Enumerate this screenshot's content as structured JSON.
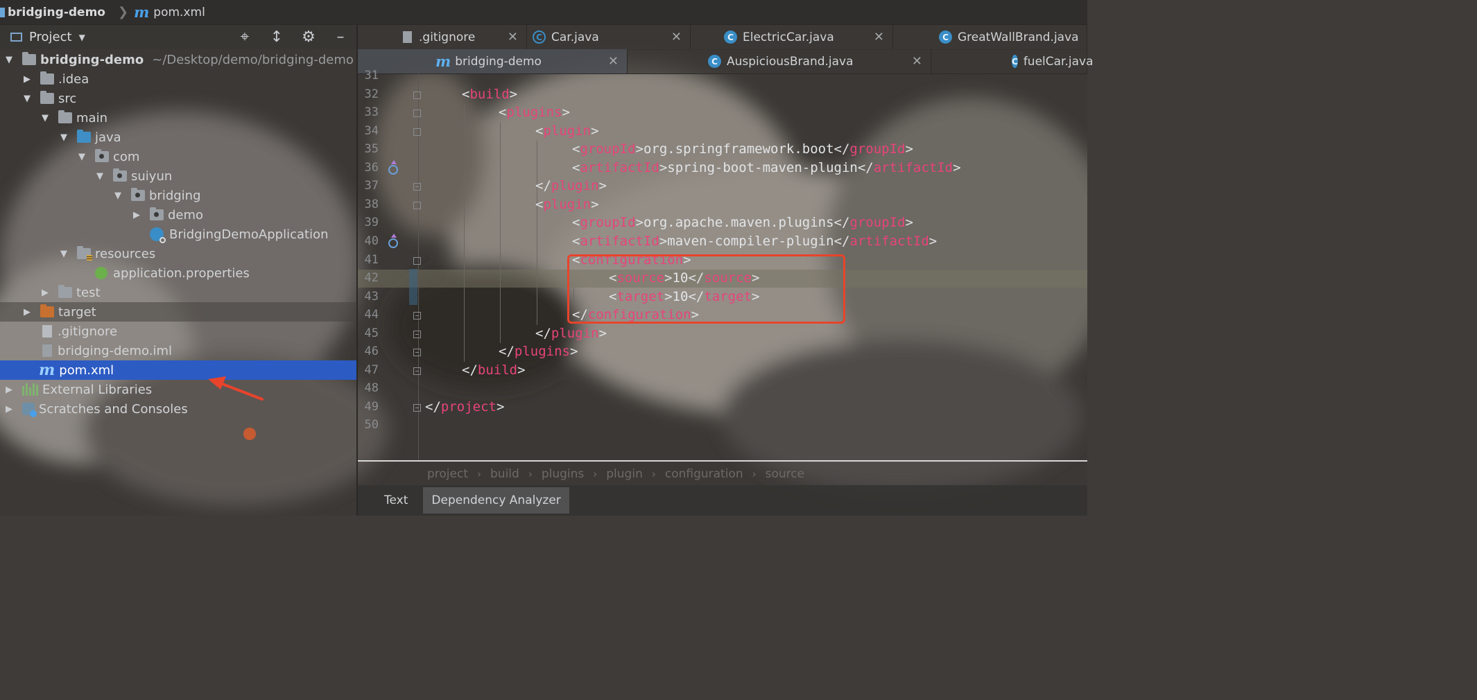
{
  "navbar": {
    "project": "bridging-demo",
    "file": "pom.xml",
    "file_icon": "m"
  },
  "project_panel": {
    "title": "Project",
    "tools": [
      "locate-icon",
      "collapse-icon",
      "gear-icon",
      "minimize-icon"
    ]
  },
  "tree": [
    {
      "label": "bridging-demo",
      "path": "~/Desktop/demo/bridging-demo",
      "level": 0,
      "arrow": "down",
      "icon": "module-folder",
      "bold": true
    },
    {
      "label": ".idea",
      "level": 1,
      "arrow": "right",
      "icon": "folder"
    },
    {
      "label": "src",
      "level": 1,
      "arrow": "down",
      "icon": "folder"
    },
    {
      "label": "main",
      "level": 2,
      "arrow": "down",
      "icon": "folder"
    },
    {
      "label": "java",
      "level": 3,
      "arrow": "down",
      "icon": "source-folder"
    },
    {
      "label": "com",
      "level": 4,
      "arrow": "down",
      "icon": "package"
    },
    {
      "label": "suiyun",
      "level": 5,
      "arrow": "down",
      "icon": "package"
    },
    {
      "label": "bridging",
      "level": 6,
      "arrow": "down",
      "icon": "package"
    },
    {
      "label": "demo",
      "level": 7,
      "arrow": "right",
      "icon": "package"
    },
    {
      "label": "BridgingDemoApplication",
      "level": 7,
      "arrow": "none",
      "icon": "spring-app"
    },
    {
      "label": "resources",
      "level": 3,
      "arrow": "down",
      "icon": "resources-folder"
    },
    {
      "label": "application.properties",
      "level": 4,
      "arrow": "none",
      "icon": "spring-properties"
    },
    {
      "label": "test",
      "level": 2,
      "arrow": "right",
      "icon": "folder"
    },
    {
      "label": "target",
      "level": 1,
      "arrow": "right",
      "icon": "excluded-folder",
      "excluded": true
    },
    {
      "label": ".gitignore",
      "level": 1,
      "arrow": "none",
      "icon": "text-file"
    },
    {
      "label": "bridging-demo.iml",
      "level": 1,
      "arrow": "none",
      "icon": "iml-file"
    },
    {
      "label": "pom.xml",
      "level": 1,
      "arrow": "none",
      "icon": "maven-file",
      "selected": true
    },
    {
      "label": "External Libraries",
      "level": 0,
      "arrow": "right",
      "icon": "libraries"
    },
    {
      "label": "Scratches and Consoles",
      "level": 0,
      "arrow": "right",
      "icon": "scratches"
    }
  ],
  "tabs_row1": [
    {
      "label": ".gitignore",
      "icon": "gitignore"
    },
    {
      "label": "Car.java",
      "icon": "interface"
    },
    {
      "label": "ElectricCar.java",
      "icon": "class"
    },
    {
      "label": "GreatWallBrand.java",
      "icon": "class"
    }
  ],
  "tabs_row2": [
    {
      "label": "bridging-demo",
      "icon": "maven",
      "active": true
    },
    {
      "label": "AuspiciousBrand.java",
      "icon": "class"
    },
    {
      "label": "fuelCar.java",
      "icon": "class"
    }
  ],
  "editor": {
    "lines": [
      {
        "n": "31",
        "indent": 0,
        "parts": []
      },
      {
        "n": "32",
        "indent": 1,
        "parts": [
          [
            "p",
            "<"
          ],
          [
            "t",
            "build"
          ],
          [
            "p",
            ">"
          ]
        ]
      },
      {
        "n": "33",
        "indent": 2,
        "parts": [
          [
            "p",
            "<"
          ],
          [
            "t",
            "plugins"
          ],
          [
            "p",
            ">"
          ]
        ]
      },
      {
        "n": "34",
        "indent": 3,
        "parts": [
          [
            "p",
            "<"
          ],
          [
            "t",
            "plugin"
          ],
          [
            "p",
            ">"
          ]
        ]
      },
      {
        "n": "35",
        "indent": 4,
        "parts": [
          [
            "p",
            "<"
          ],
          [
            "t",
            "groupId"
          ],
          [
            "p",
            ">"
          ],
          [
            "tx",
            "org.springframework.boot"
          ],
          [
            "p",
            "</"
          ],
          [
            "t",
            "groupId"
          ],
          [
            "p",
            ">"
          ]
        ]
      },
      {
        "n": "36",
        "indent": 4,
        "parts": [
          [
            "p",
            "<"
          ],
          [
            "t",
            "artifactId"
          ],
          [
            "p",
            ">"
          ],
          [
            "tx",
            "spring-boot-maven-plugin"
          ],
          [
            "p",
            "</"
          ],
          [
            "t",
            "artifactId"
          ],
          [
            "p",
            ">"
          ]
        ]
      },
      {
        "n": "37",
        "indent": 3,
        "parts": [
          [
            "p",
            "</"
          ],
          [
            "t",
            "plugin"
          ],
          [
            "p",
            ">"
          ]
        ]
      },
      {
        "n": "38",
        "indent": 3,
        "parts": [
          [
            "p",
            "<"
          ],
          [
            "t",
            "plugin"
          ],
          [
            "p",
            ">"
          ]
        ]
      },
      {
        "n": "39",
        "indent": 4,
        "parts": [
          [
            "p",
            "<"
          ],
          [
            "t",
            "groupId"
          ],
          [
            "p",
            ">"
          ],
          [
            "tx",
            "org.apache.maven.plugins"
          ],
          [
            "p",
            "</"
          ],
          [
            "t",
            "groupId"
          ],
          [
            "p",
            ">"
          ]
        ]
      },
      {
        "n": "40",
        "indent": 4,
        "parts": [
          [
            "p",
            "<"
          ],
          [
            "t",
            "artifactId"
          ],
          [
            "p",
            ">"
          ],
          [
            "tx",
            "maven-compiler-plugin"
          ],
          [
            "p",
            "</"
          ],
          [
            "t",
            "artifactId"
          ],
          [
            "p",
            ">"
          ]
        ]
      },
      {
        "n": "41",
        "indent": 4,
        "parts": [
          [
            "p",
            "<"
          ],
          [
            "t",
            "configuration"
          ],
          [
            "p",
            ">"
          ]
        ]
      },
      {
        "n": "42",
        "indent": 5,
        "parts": [
          [
            "p",
            "<"
          ],
          [
            "t",
            "source"
          ],
          [
            "p",
            ">"
          ],
          [
            "tx",
            "10"
          ],
          [
            "p",
            "</"
          ],
          [
            "t",
            "source"
          ],
          [
            "p",
            ">"
          ]
        ],
        "current": true
      },
      {
        "n": "43",
        "indent": 5,
        "parts": [
          [
            "p",
            "<"
          ],
          [
            "t",
            "target"
          ],
          [
            "p",
            ">"
          ],
          [
            "tx",
            "10"
          ],
          [
            "p",
            "</"
          ],
          [
            "t",
            "target"
          ],
          [
            "p",
            ">"
          ]
        ]
      },
      {
        "n": "44",
        "indent": 4,
        "parts": [
          [
            "p",
            "</"
          ],
          [
            "t",
            "configuration"
          ],
          [
            "p",
            ">"
          ]
        ]
      },
      {
        "n": "45",
        "indent": 3,
        "parts": [
          [
            "p",
            "</"
          ],
          [
            "t",
            "plugin"
          ],
          [
            "p",
            ">"
          ]
        ]
      },
      {
        "n": "46",
        "indent": 2,
        "parts": [
          [
            "p",
            "</"
          ],
          [
            "t",
            "plugins"
          ],
          [
            "p",
            ">"
          ]
        ]
      },
      {
        "n": "47",
        "indent": 1,
        "parts": [
          [
            "p",
            "</"
          ],
          [
            "t",
            "build"
          ],
          [
            "p",
            ">"
          ]
        ]
      },
      {
        "n": "48",
        "indent": 0,
        "parts": []
      },
      {
        "n": "49",
        "indent": 0,
        "parts": [
          [
            "p",
            "</"
          ],
          [
            "t",
            "project"
          ],
          [
            "p",
            ">"
          ]
        ]
      },
      {
        "n": "50",
        "indent": 0,
        "parts": []
      }
    ]
  },
  "breadcrumb": [
    "project",
    "build",
    "plugins",
    "plugin",
    "configuration",
    "source"
  ],
  "bottom_tabs": [
    {
      "label": "Text",
      "active": false
    },
    {
      "label": "Dependency Analyzer",
      "active": true
    }
  ],
  "colors": {
    "selection": "#2c5bc3",
    "xml_tag": "#e8447a",
    "annotation_box": "#e8442b",
    "annotation_arrow": "#e8442b"
  }
}
